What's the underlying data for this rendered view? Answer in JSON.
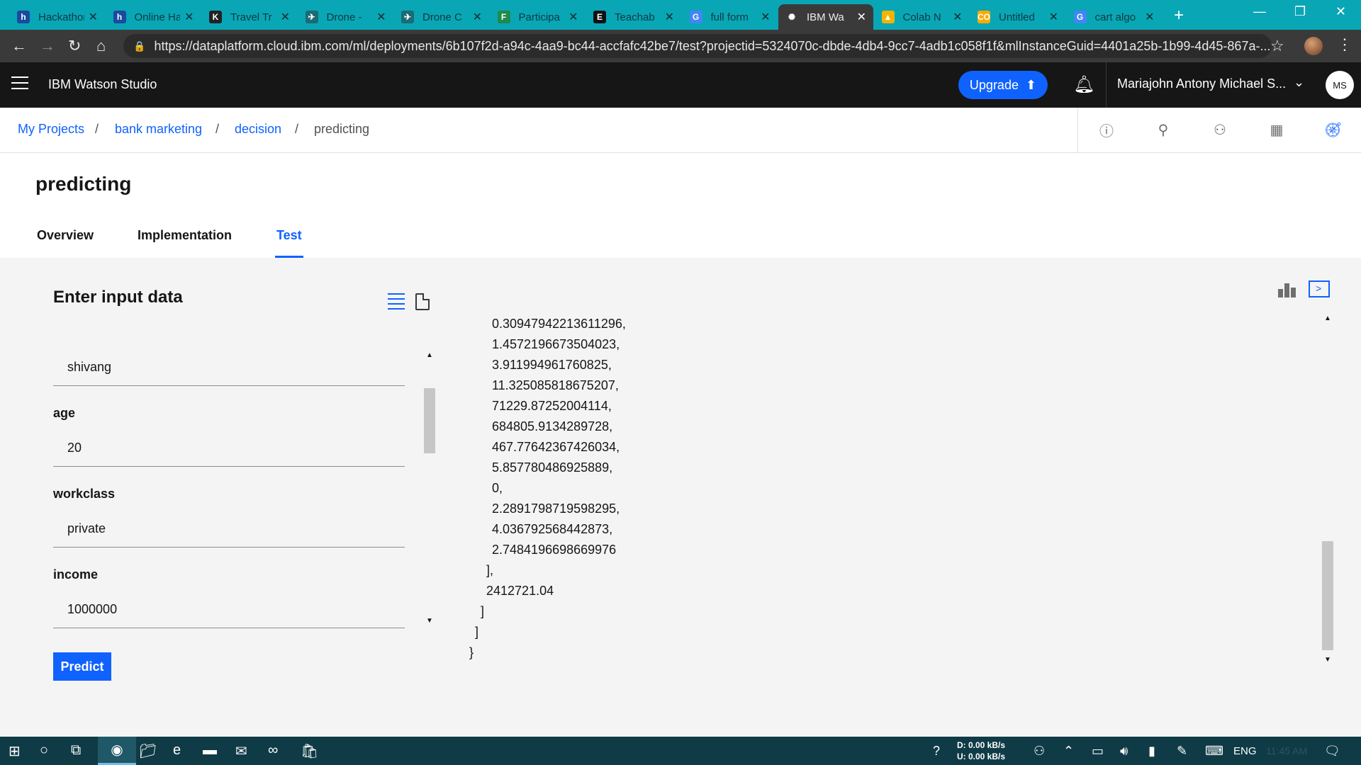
{
  "browser": {
    "tabs": [
      {
        "title": "Hackathon",
        "favicon": "h",
        "color": "#1a4a9e"
      },
      {
        "title": "Online Hackathon",
        "favicon": "h",
        "color": "#1a4a9e"
      },
      {
        "title": "Travel Tr",
        "favicon": "K",
        "color": "#222222"
      },
      {
        "title": "Drone - ",
        "favicon": "✈",
        "color": "#1a6b75"
      },
      {
        "title": "Drone C",
        "favicon": "✈",
        "color": "#1a6b75"
      },
      {
        "title": "Participa",
        "favicon": "F",
        "color": "#1f8a4c"
      },
      {
        "title": "Teachab",
        "favicon": "E",
        "color": "#111111"
      },
      {
        "title": "full form",
        "favicon": "G",
        "color": "#4285f4"
      },
      {
        "title": "IBM Wa",
        "favicon": "✺",
        "color": "#3a3a3a"
      },
      {
        "title": "Colab N",
        "favicon": "▲",
        "color": "#f4b400"
      },
      {
        "title": "Untitled",
        "favicon": "CO",
        "color": "#f9ab00"
      },
      {
        "title": "cart algo",
        "favicon": "G",
        "color": "#4285f4"
      }
    ],
    "url": "https://dataplatform.cloud.ibm.com/ml/deployments/6b107f2d-a94c-4aa9-bc44-accfafc42be7/test?projectid=5324070c-dbde-4db4-9cc7-4adb1c058f1f&mlInstanceGuid=4401a25b-1b99-4d45-867a-..."
  },
  "header": {
    "brand": "IBM Watson Studio",
    "upgrade_label": "Upgrade",
    "user_name": "Mariajohn Antony Michael S...",
    "avatar_initials": "MS"
  },
  "breadcrumb": {
    "items": [
      "My Projects",
      "bank marketing",
      "decision",
      "predicting"
    ],
    "separator": "/"
  },
  "page": {
    "title": "predicting",
    "tabs": [
      "Overview",
      "Implementation",
      "Test"
    ],
    "active_tab": "Test"
  },
  "input_panel": {
    "title": "Enter input data",
    "first_value": "shivang",
    "fields": [
      {
        "label": "age",
        "value": "20"
      },
      {
        "label": "workclass",
        "value": "private"
      },
      {
        "label": "income",
        "value": "1000000"
      }
    ],
    "predict_label": "Predict"
  },
  "output": {
    "lines": [
      "0.30947942213611296,",
      "1.4572196673504023,",
      "3.911994961760825,",
      "11.325085818675207,",
      "71229.87252004114,",
      "684805.9134289728,",
      "467.77642367426034,",
      "5.857780486925889,",
      "0,",
      "2.2891798719598295,",
      "4.036792568442873,",
      "2.7484196698669976",
      "],",
      "2412721.04",
      "]",
      "]",
      "}"
    ]
  },
  "taskbar": {
    "net_down": "D:   0.00 kB/s",
    "net_up": "U:   0.00 kB/s",
    "language": "ENG",
    "time": "11:45 AM"
  }
}
